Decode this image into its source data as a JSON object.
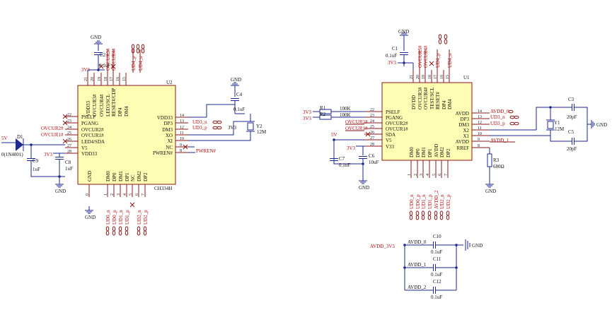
{
  "colors": {
    "wire": "#1d2a8f",
    "pin": "#8a1a1a",
    "chip_fill": "#fffcb3",
    "net_label": "#b01010",
    "background": "#ffffff"
  },
  "left": {
    "chip": {
      "designator": "U2",
      "part": "CH334H",
      "left_pins": [
        {
          "num": "22",
          "name": "PSELF"
        },
        {
          "num": "23",
          "name": "PGANG"
        },
        {
          "num": "24",
          "name": "OVCUR2#"
        },
        {
          "num": "25",
          "name": "OVCUR1#"
        },
        {
          "num": "26",
          "name": "LED4/SDA"
        },
        {
          "num": "27",
          "name": "V5"
        },
        {
          "num": "28",
          "name": "VDD33"
        }
      ],
      "right_pins": [
        {
          "num": "14",
          "name": "VDD33"
        },
        {
          "num": "13",
          "name": "DP3"
        },
        {
          "num": "12",
          "name": "DM3"
        },
        {
          "num": "11",
          "name": "XO"
        },
        {
          "num": "10",
          "name": "XI"
        },
        {
          "num": "9",
          "name": "NC"
        },
        {
          "num": "8",
          "name": "PWREN#"
        }
      ],
      "top_pins": [
        {
          "num": "21",
          "name": "VDD33"
        },
        {
          "num": "20",
          "name": "OVCUR3#"
        },
        {
          "num": "19",
          "name": "OVCUR4#"
        },
        {
          "num": "18",
          "name": "LED3/SCL"
        },
        {
          "num": "17",
          "name": "RESET#/CDP"
        },
        {
          "num": "16",
          "name": "DP4"
        },
        {
          "num": "15",
          "name": "DM4"
        }
      ],
      "bottom_pins": [
        {
          "num": "0",
          "name": "GND"
        },
        {
          "num": "1",
          "name": "DM0"
        },
        {
          "num": "2",
          "name": "DP0"
        },
        {
          "num": "3",
          "name": "DM1"
        },
        {
          "num": "4",
          "name": "DP1"
        },
        {
          "num": "5",
          "name": "NC"
        },
        {
          "num": "6",
          "name": "DM2"
        },
        {
          "num": "7",
          "name": "DP2"
        }
      ]
    },
    "top_nets": [
      "OVCUR3#",
      "OVCUR4#",
      "UD4_p",
      "UD4_n"
    ],
    "bottom_nets": [
      "UD0_n",
      "UD0_p",
      "UD1_n",
      "UD1_p",
      "UD2_n",
      "UD2_p"
    ],
    "dp3_net": "UD3_n",
    "dm3_net": "UD3_p",
    "pwren_net": "PWREN#",
    "left_nets": [
      "OVCUR2#",
      "OVCUR1#"
    ],
    "c2": {
      "ref": "C2",
      "value": "0.1uF"
    },
    "c4": {
      "ref": "C4",
      "value": "0.1uF"
    },
    "y2": {
      "ref": "Y2",
      "value": "12M"
    },
    "d1": {
      "ref": "D1",
      "value": "0(1N4001)"
    },
    "c9": {
      "ref": "C9",
      "value": "1uF"
    },
    "c8": {
      "ref": "C8",
      "value": "1uF"
    },
    "v5": "5V",
    "v3": "3V3",
    "gnd": "GND"
  },
  "right": {
    "chip": {
      "designator": "U1",
      "left_pins": [
        {
          "num": "22",
          "name": "PSELF"
        },
        {
          "num": "23",
          "name": "PGANG"
        },
        {
          "num": "24",
          "name": "OVCUR2#"
        },
        {
          "num": "25",
          "name": "OVCUR1#"
        },
        {
          "num": "26",
          "name": "SDA"
        },
        {
          "num": "27",
          "name": "V5"
        },
        {
          "num": "28",
          "name": "V33"
        }
      ],
      "right_pins": [
        {
          "num": "14",
          "name": "AVDD"
        },
        {
          "num": "13",
          "name": "DP3"
        },
        {
          "num": "12",
          "name": "DM3"
        },
        {
          "num": "11",
          "name": "X2"
        },
        {
          "num": "10",
          "name": "X1"
        },
        {
          "num": "9",
          "name": "AVDD"
        },
        {
          "num": "8",
          "name": "RREF"
        }
      ],
      "top_pins": [
        {
          "num": "21",
          "name": "DVDD"
        },
        {
          "num": "20",
          "name": "OVCUR3#"
        },
        {
          "num": "19",
          "name": "OVCUR4#"
        },
        {
          "num": "18",
          "name": "TEST/SCL"
        },
        {
          "num": "17",
          "name": "RESET#"
        },
        {
          "num": "16",
          "name": "DP4"
        },
        {
          "num": "15",
          "name": "DM4"
        }
      ],
      "bottom_pins": [
        {
          "num": "1",
          "name": "DM0"
        },
        {
          "num": "2",
          "name": "DP0"
        },
        {
          "num": "3",
          "name": "DM1"
        },
        {
          "num": "4",
          "name": "DP1"
        },
        {
          "num": "5",
          "name": "AVDD"
        },
        {
          "num": "6",
          "name": "DM2"
        },
        {
          "num": "7",
          "name": "DP2"
        }
      ]
    },
    "top_nets": [
      "OVCUR3#",
      "OVCUR4#",
      "UD4_p",
      "UD4_n"
    ],
    "bottom_nets": [
      "UD0_n",
      "UD0_p",
      "UD1_n",
      "UD1_p",
      "AVDD_2",
      "UD2_n",
      "UD2_p"
    ],
    "left_nets": [
      "OVCUR2#",
      "OVCUR1#"
    ],
    "r1": {
      "ref": "R1",
      "value": "100K"
    },
    "r2": {
      "ref": "R2",
      "value": "100K"
    },
    "c1": {
      "ref": "C1",
      "value": "0.1uF"
    },
    "c7": {
      "ref": "C7",
      "value": "0.1uF"
    },
    "c6": {
      "ref": "C6",
      "value": "10uF"
    },
    "c3": {
      "ref": "C3",
      "value": "20pF"
    },
    "c5": {
      "ref": "C5",
      "value": "20pF"
    },
    "y1": {
      "ref": "Y1",
      "value": "12M"
    },
    "r3": {
      "ref": "R3",
      "value": "680Ω"
    },
    "avdd0": "AVDD_0",
    "avdd1": "AVDD_1",
    "dp3_net": "UD3_n",
    "dm3_net": "UD3_p",
    "v5": "5V",
    "v3": "3V3",
    "gnd": "GND"
  },
  "decoupling": {
    "input": "AVDD_3V3",
    "rows": [
      {
        "net": "AVDD_0",
        "ref": "C10",
        "value": "0.1uF"
      },
      {
        "net": "AVDD_1",
        "ref": "C11",
        "value": "0.1uF"
      },
      {
        "net": "AVDD_2",
        "ref": "C12",
        "value": "0.1uF"
      }
    ],
    "gnd": "GND"
  }
}
